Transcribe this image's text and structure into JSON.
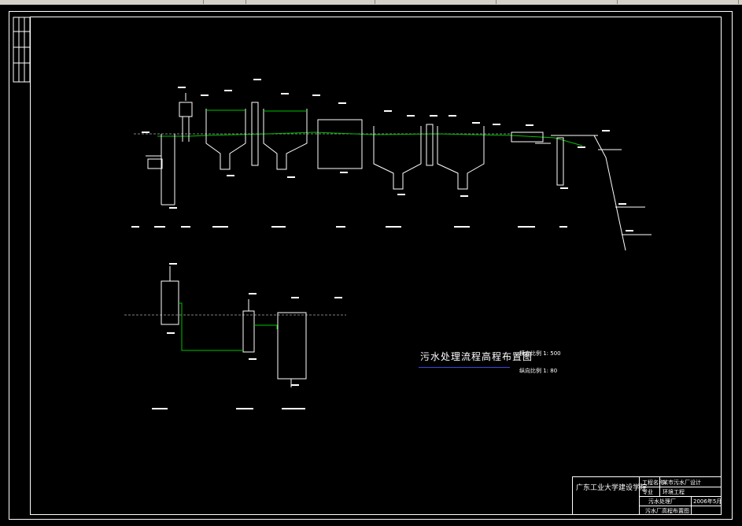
{
  "drawing": {
    "title": "污水处理流程高程布置图",
    "scale_h": "横向比例 1: 500",
    "scale_v": "纵向比例 1: 80"
  },
  "units_top": [
    {
      "name": "格栅",
      "elev_top": "74.560"
    },
    {
      "name": "提升泵房",
      "elev_top": "73.870"
    },
    {
      "name": "沉砂池",
      "elev_top": "74.575"
    },
    {
      "name": "初次沉淀池",
      "elev_top": "74.365"
    },
    {
      "name": "初次沉淀池",
      "elev_top": "74.145"
    },
    {
      "name": "曝气池",
      "elev_top": "73.945"
    },
    {
      "name": "二次沉淀池",
      "elev_top": "73.675"
    },
    {
      "name": "二次沉淀池",
      "elev_top": "73.445"
    },
    {
      "name": "接触消毒池",
      "elev_top": "73.075"
    },
    {
      "name": "出水井",
      "elev_top": "72.815"
    }
  ],
  "river": {
    "label_outlet": "排水渠",
    "label_mid": "河常年平均水位",
    "label_mid_val": "66.200",
    "label_low": "最低水位",
    "label_low_val": "63.700"
  },
  "units_bottom": [
    {
      "name": "剩余污泥泵"
    },
    {
      "name": "污泥浓缩池"
    },
    {
      "name": "污泥脱水机房"
    }
  ],
  "title_block": {
    "school": "广东工业大学建设学院",
    "r1c1": "工程名称",
    "r1c2": "某市污水厂设计",
    "r2c1": "专业",
    "r2c2": "环境工程",
    "r3": "污水处理厂",
    "r4": "污水厂高程布置图",
    "sheet": "2006年5月"
  },
  "colors": {
    "line": "#ffffff",
    "water": "#00c000",
    "title_rule": "#3a4bd8",
    "level": "#00bfff"
  }
}
